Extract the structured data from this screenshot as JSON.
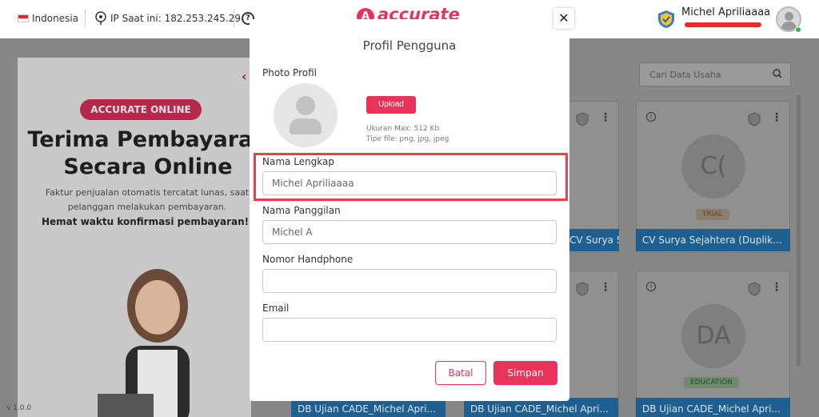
{
  "topbar": {
    "language": "Indonesia",
    "ip_label": "IP Saat ini: 182.253.245.29",
    "brand": "accurate",
    "brand_mark": "A",
    "user_name": "Michel Apriliaaaa"
  },
  "banner": {
    "pill": "ACCURATE ONLINE",
    "heading": "Terima Pembayaran Secara Online",
    "description": "Faktur penjualan otomatis tercatat lunas, saat pelanggan melakukan pembayaran.",
    "highlight": "Hemat waktu konfirmasi pembayaran!",
    "version": "v 1.0.0"
  },
  "search": {
    "placeholder": "Cari Data Usaha"
  },
  "cards": [
    {
      "title": "CV Surya Sejahtera",
      "initials": "",
      "badge": ""
    },
    {
      "title": "CV Surya Sejahtera (Duplik...",
      "initials": "C(",
      "badge": "TRIAL"
    },
    {
      "title": "DB Ujian CADE_Michel Apri...",
      "initials": "",
      "badge": ""
    },
    {
      "title": "DB Ujian CADE_Michel Apri...",
      "initials": "",
      "badge": ""
    },
    {
      "title": "DB Ujian CADE_Michel Apri...",
      "initials": "DA",
      "badge": "EDUCATION"
    }
  ],
  "modal": {
    "title": "Profil Pengguna",
    "close": "✕",
    "photo_label": "Photo Profil",
    "upload_label": "Upload",
    "upload_max": "Ukuran Max: 512 Kb",
    "upload_types": "Tipe file: png, jpg, jpeg",
    "fields": {
      "full_name": {
        "label": "Nama Lengkap",
        "value": "Michel Apriliaaaa"
      },
      "nickname": {
        "label": "Nama Panggilan",
        "value": "Michel A"
      },
      "phone": {
        "label": "Nomor Handphone",
        "value": ""
      },
      "email": {
        "label": "Email",
        "value": ""
      }
    },
    "cancel_label": "Batal",
    "save_label": "Simpan"
  },
  "colors": {
    "accent": "#e8335b",
    "highlight": "#e8404d",
    "card_title": "#1f5f8f"
  }
}
